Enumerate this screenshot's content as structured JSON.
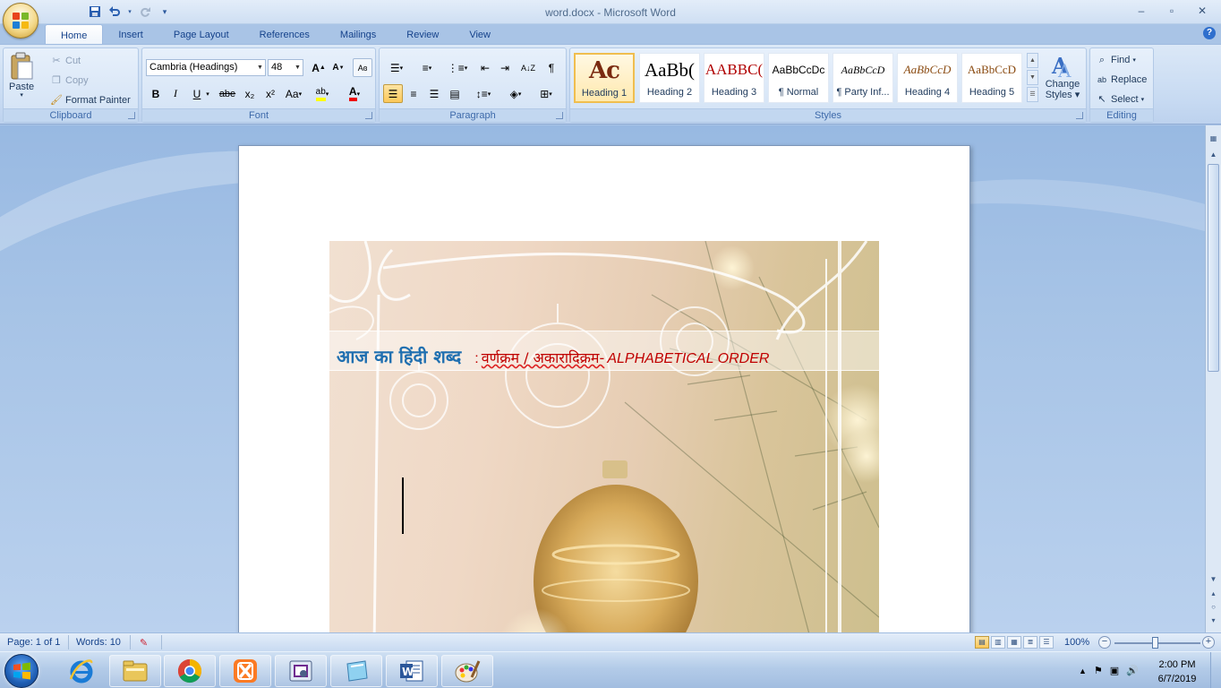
{
  "window": {
    "title": "word.docx - Microsoft Word",
    "min": "–",
    "max": "▫",
    "close": "✕"
  },
  "qat": {
    "save": "save-icon",
    "undo": "undo-icon",
    "redo": "redo-icon",
    "customize": "customize-icon"
  },
  "tabs": [
    "Home",
    "Insert",
    "Page Layout",
    "References",
    "Mailings",
    "Review",
    "View"
  ],
  "active_tab": "Home",
  "help": "?",
  "clipboard": {
    "paste": "Paste",
    "cut": "Cut",
    "copy": "Copy",
    "format_painter": "Format Painter",
    "label": "Clipboard"
  },
  "font": {
    "name": "Cambria (Headings)",
    "size": "48",
    "label": "Font",
    "bold": "B",
    "italic": "I",
    "underline": "U",
    "strike": "abe",
    "sub": "x₂",
    "sup": "x²",
    "case": "Aa",
    "grow": "A",
    "shrink": "A",
    "highlight": "ab",
    "color": "A"
  },
  "paragraph": {
    "label": "Paragraph",
    "show_marks": "¶"
  },
  "styles": {
    "label": "Styles",
    "items": [
      {
        "preview": "Ac",
        "name": "Heading 1"
      },
      {
        "preview": "AaBb(",
        "name": "Heading 2"
      },
      {
        "preview": "AABBC(",
        "name": "Heading 3"
      },
      {
        "preview": "AaBbCcDc",
        "name": "¶ Normal"
      },
      {
        "preview": "AaBbCcD",
        "name": "¶ Party Inf..."
      },
      {
        "preview": "AaBbCcD",
        "name": "Heading 4"
      },
      {
        "preview": "AaBbCcD",
        "name": "Heading 5"
      }
    ],
    "change": "Change",
    "change2": "Styles"
  },
  "editing": {
    "find": "Find",
    "replace": "Replace",
    "select": "Select",
    "label": "Editing"
  },
  "document": {
    "heading_hindi": "आज का हिंदी शब्द",
    "separator": ":",
    "word_hindi": "वर्णक्रम / अकारादिक्रम-",
    "word_english": "ALPHABETICAL ORDER"
  },
  "status": {
    "page": "Page: 1 of 1",
    "words": "Words: 10",
    "zoom": "100%"
  },
  "clock": {
    "time": "2:00 PM",
    "date": "6/7/2019"
  },
  "colors": {
    "accent": "#15428b",
    "heading_blue": "#1f6fb0",
    "heading_red": "#c00000",
    "ribbon_bg": "#dbe8f7"
  }
}
